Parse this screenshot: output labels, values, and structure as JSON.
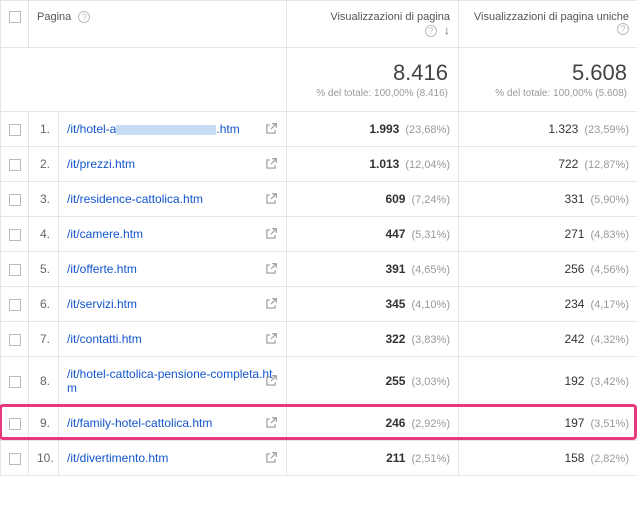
{
  "header": {
    "page_label": "Pagina",
    "views_label": "Visualizzazioni di pagina",
    "uviews_label": "Visualizzazioni di pagina uniche"
  },
  "totals": {
    "views_value": "8.416",
    "views_sub": "% del totale: 100,00% (8.416)",
    "uviews_value": "5.608",
    "uviews_sub": "% del totale: 100,00% (5.608)"
  },
  "rows": [
    {
      "idx": "1.",
      "page_pre": "/it/hotel-a",
      "obscured": true,
      "page_post": ".htm",
      "views": "1.993",
      "views_pct": "(23,68%)",
      "uviews": "1.323",
      "uviews_pct": "(23,59%)"
    },
    {
      "idx": "2.",
      "page": "/it/prezzi.htm",
      "views": "1.013",
      "views_pct": "(12,04%)",
      "uviews": "722",
      "uviews_pct": "(12,87%)"
    },
    {
      "idx": "3.",
      "page": "/it/residence-cattolica.htm",
      "views": "609",
      "views_pct": "(7,24%)",
      "uviews": "331",
      "uviews_pct": "(5,90%)"
    },
    {
      "idx": "4.",
      "page": "/it/camere.htm",
      "views": "447",
      "views_pct": "(5,31%)",
      "uviews": "271",
      "uviews_pct": "(4,83%)"
    },
    {
      "idx": "5.",
      "page": "/it/offerte.htm",
      "views": "391",
      "views_pct": "(4,65%)",
      "uviews": "256",
      "uviews_pct": "(4,56%)"
    },
    {
      "idx": "6.",
      "page": "/it/servizi.htm",
      "views": "345",
      "views_pct": "(4,10%)",
      "uviews": "234",
      "uviews_pct": "(4,17%)"
    },
    {
      "idx": "7.",
      "page": "/it/contatti.htm",
      "views": "322",
      "views_pct": "(3,83%)",
      "uviews": "242",
      "uviews_pct": "(4,32%)"
    },
    {
      "idx": "8.",
      "page": "/it/hotel-cattolica-pensione-completa.htm",
      "views": "255",
      "views_pct": "(3,03%)",
      "uviews": "192",
      "uviews_pct": "(3,42%)"
    },
    {
      "idx": "9.",
      "page": "/it/family-hotel-cattolica.htm",
      "views": "246",
      "views_pct": "(2,92%)",
      "uviews": "197",
      "uviews_pct": "(3,51%)"
    },
    {
      "idx": "10.",
      "page": "/it/divertimento.htm",
      "views": "211",
      "views_pct": "(2,51%)",
      "uviews": "158",
      "uviews_pct": "(2,82%)"
    }
  ],
  "highlight_index": 8
}
